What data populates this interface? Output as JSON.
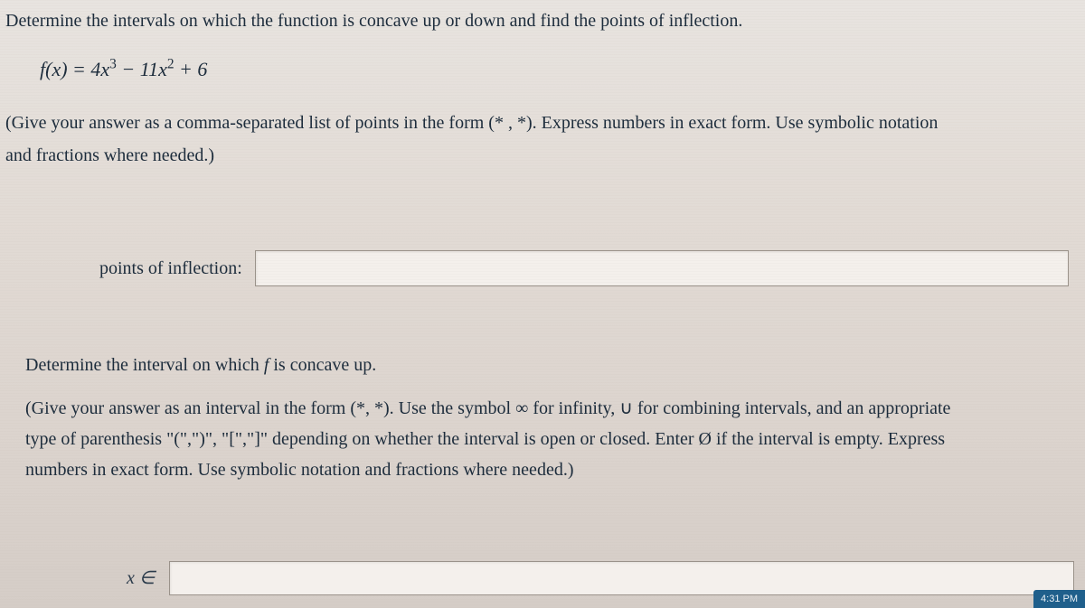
{
  "problem": {
    "intro": "Determine the intervals on which the function is concave up or down and find the points of inflection.",
    "equation_html": "f(x) = 4x³ − 11x² + 6",
    "instructions_line1": "(Give your answer as a comma-separated list of points in the form (* , *). Express numbers in exact form. Use symbolic notation",
    "instructions_line2": "and fractions where needed.)"
  },
  "answer1": {
    "label": "points of inflection:",
    "value": "",
    "placeholder": ""
  },
  "section2": {
    "title_prefix": "Determine the interval on which ",
    "title_func": "f",
    "title_suffix": " is concave up.",
    "instr_line1": "(Give your answer as an interval in the form (*, *). Use the symbol ∞ for infinity, ∪ for combining intervals, and an appropriate",
    "instr_line2": "type of parenthesis \"(\",\")\", \"[\",\"]\" depending on whether the interval is open or closed. Enter Ø if the interval is empty. Express",
    "instr_line3": "numbers in exact form. Use symbolic notation and fractions where needed.)"
  },
  "answer2": {
    "label": "x ∈",
    "value": "",
    "placeholder": ""
  },
  "clock": "4:31 PM"
}
